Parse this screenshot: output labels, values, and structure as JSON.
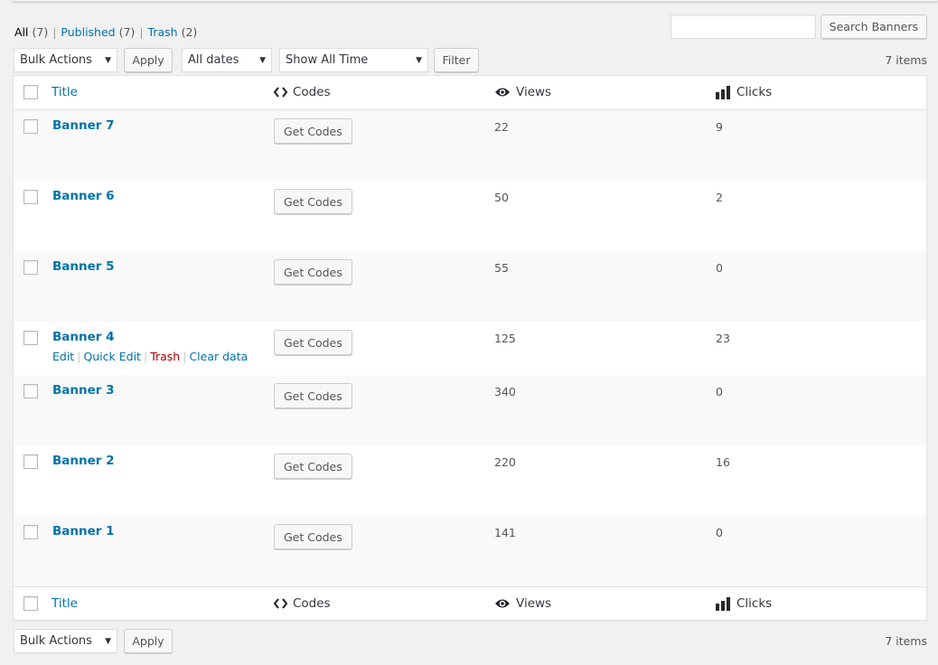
{
  "views": {
    "all": {
      "label": "All",
      "count": "(7)"
    },
    "published": {
      "label": "Published",
      "count": "(7)"
    },
    "trash": {
      "label": "Trash",
      "count": "(2)"
    },
    "separator": "|"
  },
  "search": {
    "value": "",
    "placeholder": "",
    "button_label": "Search Banners"
  },
  "tablenav_top": {
    "bulk_actions": "Bulk Actions",
    "apply_label": "Apply",
    "date_filter": "All dates",
    "time_filter": "Show All Time",
    "filter_label": "Filter",
    "items_count": "7 items"
  },
  "tablenav_bottom": {
    "bulk_actions": "Bulk Actions",
    "apply_label": "Apply",
    "items_count": "7 items"
  },
  "columns": {
    "title": "Title",
    "codes": "Codes",
    "views": "Views",
    "clicks": "Clicks",
    "icons": {
      "codes": "code-brackets-icon",
      "views": "eye-icon",
      "clicks": "bar-chart-icon"
    }
  },
  "rows": [
    {
      "title": "Banner 7",
      "button": "Get Codes",
      "views": "22",
      "clicks": "9"
    },
    {
      "title": "Banner 6",
      "button": "Get Codes",
      "views": "50",
      "clicks": "2"
    },
    {
      "title": "Banner 5",
      "button": "Get Codes",
      "views": "55",
      "clicks": "0"
    },
    {
      "title": "Banner 4",
      "button": "Get Codes",
      "views": "125",
      "clicks": "23",
      "actions": {
        "edit": "Edit",
        "quick_edit": "Quick Edit",
        "trash": "Trash",
        "clear_data": "Clear data"
      }
    },
    {
      "title": "Banner 3",
      "button": "Get Codes",
      "views": "340",
      "clicks": "0"
    },
    {
      "title": "Banner 2",
      "button": "Get Codes",
      "views": "220",
      "clicks": "16"
    },
    {
      "title": "Banner 1",
      "button": "Get Codes",
      "views": "141",
      "clicks": "0"
    }
  ],
  "colors": {
    "link": "#0073aa",
    "trash": "#aa0000",
    "background": "#f1f1f1",
    "row_alt": "#f9f9f9"
  }
}
